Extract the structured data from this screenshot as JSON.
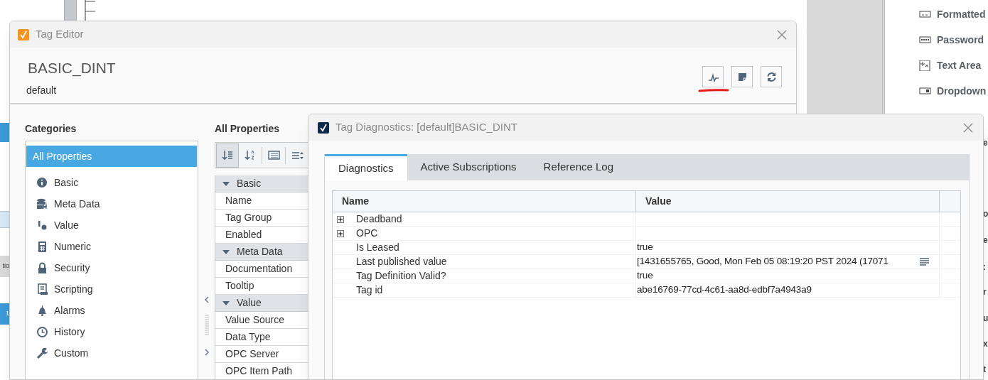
{
  "background": {
    "left_fragments": [
      {
        "text": "tio",
        "kind": "gray"
      },
      {
        "text": "1",
        "kind": "blue"
      }
    ],
    "palette": [
      "Formatted",
      "Password",
      "Text Area",
      "Dropdown"
    ],
    "right_fragments": [
      "e",
      "o",
      "e",
      ":",
      "r",
      "u",
      "x",
      "t"
    ]
  },
  "tag_editor": {
    "title": "Tag Editor",
    "tag_name": "BASIC_DINT",
    "provider": "default",
    "categories_heading": "Categories",
    "categories": [
      {
        "label": "All Properties",
        "selected": true
      },
      {
        "label": "Basic",
        "selected": false
      },
      {
        "label": "Meta Data",
        "selected": false
      },
      {
        "label": "Value",
        "selected": false
      },
      {
        "label": "Numeric",
        "selected": false
      },
      {
        "label": "Security",
        "selected": false
      },
      {
        "label": "Scripting",
        "selected": false
      },
      {
        "label": "Alarms",
        "selected": false
      },
      {
        "label": "History",
        "selected": false
      },
      {
        "label": "Custom",
        "selected": false
      }
    ],
    "properties_heading": "All Properties",
    "toolbar": [
      {
        "selected": true
      },
      {
        "selected": false
      },
      {
        "selected": false
      },
      {
        "selected": false
      }
    ],
    "properties": [
      {
        "kind": "group",
        "label": "Basic"
      },
      {
        "kind": "property",
        "label": "Name"
      },
      {
        "kind": "property",
        "label": "Tag Group"
      },
      {
        "kind": "property",
        "label": "Enabled"
      },
      {
        "kind": "group",
        "label": "Meta Data"
      },
      {
        "kind": "property",
        "label": "Documentation"
      },
      {
        "kind": "property",
        "label": "Tooltip"
      },
      {
        "kind": "group",
        "label": "Value"
      },
      {
        "kind": "property",
        "label": "Value Source"
      },
      {
        "kind": "property",
        "label": "Data Type"
      },
      {
        "kind": "property",
        "label": "OPC Server"
      },
      {
        "kind": "property",
        "label": "OPC Item Path"
      }
    ]
  },
  "diagnostics": {
    "title": "Tag Diagnostics: [default]BASIC_DINT",
    "tabs": [
      {
        "label": "Diagnostics",
        "selected": true
      },
      {
        "label": "Active Subscriptions",
        "selected": false
      },
      {
        "label": "Reference Log",
        "selected": false
      }
    ],
    "columns": [
      "Name",
      "Value"
    ],
    "rows": [
      {
        "kind": "group",
        "name": "Deadband",
        "expanded": false
      },
      {
        "kind": "group",
        "name": "OPC",
        "expanded": false
      },
      {
        "kind": "value",
        "name": "Is Leased",
        "value": "true"
      },
      {
        "kind": "detail",
        "name": "Last published value",
        "value": "[1431655765, Good, Mon Feb 05 08:19:20 PST 2024 (17071"
      },
      {
        "kind": "value",
        "name": "Tag Definition Valid?",
        "value": "true"
      },
      {
        "kind": "value",
        "name": "Tag id",
        "value": "abe16769-77cd-4c61-aa8d-edbf7a4943a9"
      }
    ]
  }
}
